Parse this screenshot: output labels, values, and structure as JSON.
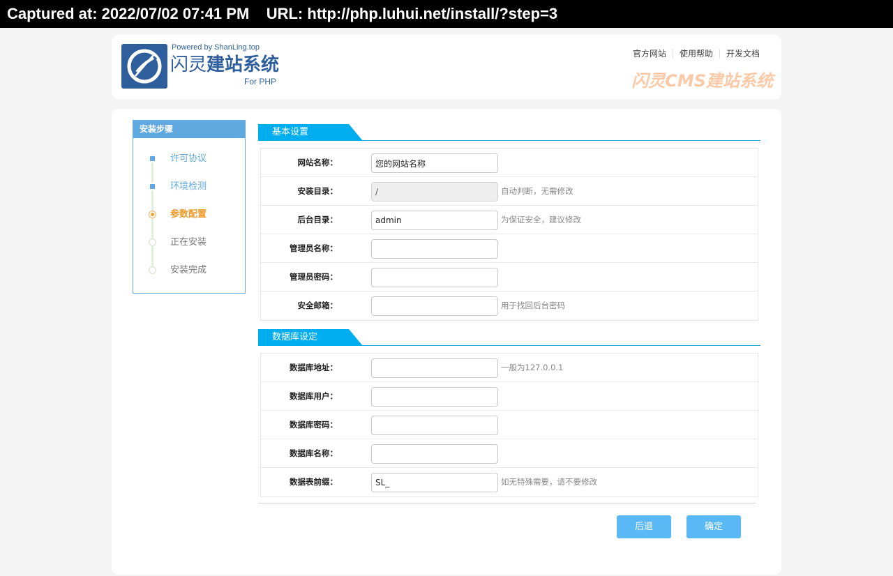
{
  "capture": {
    "text": "Captured at: 2022/07/02 07:41 PM    URL: http://php.luhui.net/install/?step=3"
  },
  "header": {
    "logo_icon": "shanling-logo-icon",
    "powered_by": "Powered by ShanLing.top",
    "title_light": "闪灵",
    "title_bold": "建站系统",
    "subtitle": "For PHP",
    "links": [
      "官方网站",
      "使用帮助",
      "开发文档"
    ],
    "slogan": "闪灵CMS建站系统"
  },
  "steps": {
    "title": "安装步骤",
    "items": [
      {
        "label": "许可协议",
        "state": "done"
      },
      {
        "label": "环境检测",
        "state": "done"
      },
      {
        "label": "参数配置",
        "state": "current"
      },
      {
        "label": "正在安装",
        "state": "todo"
      },
      {
        "label": "安装完成",
        "state": "todo"
      }
    ]
  },
  "basic": {
    "title": "基本设置",
    "fields": [
      {
        "label": "网站名称：",
        "value": "您的网站名称",
        "hint": "",
        "readonly": false
      },
      {
        "label": "安装目录：",
        "value": "/",
        "hint": "自动判断，无需修改",
        "readonly": true
      },
      {
        "label": "后台目录：",
        "value": "admin",
        "hint": "为保证安全，建议修改",
        "readonly": false
      },
      {
        "label": "管理员名称：",
        "value": "",
        "hint": "",
        "readonly": false
      },
      {
        "label": "管理员密码：",
        "value": "",
        "hint": "",
        "readonly": false
      },
      {
        "label": "安全邮箱：",
        "value": "",
        "hint": "用于找回后台密码",
        "readonly": false
      }
    ]
  },
  "database": {
    "title": "数据库设定",
    "fields": [
      {
        "label": "数据库地址：",
        "value": "",
        "hint": "一般为127.0.0.1",
        "readonly": false
      },
      {
        "label": "数据库用户：",
        "value": "",
        "hint": "",
        "readonly": false
      },
      {
        "label": "数据库密码：",
        "value": "",
        "hint": "",
        "readonly": false
      },
      {
        "label": "数据库名称：",
        "value": "",
        "hint": "",
        "readonly": false
      },
      {
        "label": "数据表前缀：",
        "value": "SL_",
        "hint": "如无特殊需要，请不要修改",
        "readonly": false
      }
    ]
  },
  "buttons": {
    "back": "后退",
    "confirm": "确定"
  },
  "colors": {
    "accent": "#00aeef",
    "button": "#5ab9f4",
    "step_done": "#5fa9e0",
    "step_current": "#ef9a2a",
    "brand_blue": "#2e5f9c",
    "slogan": "#fbc9a6"
  }
}
